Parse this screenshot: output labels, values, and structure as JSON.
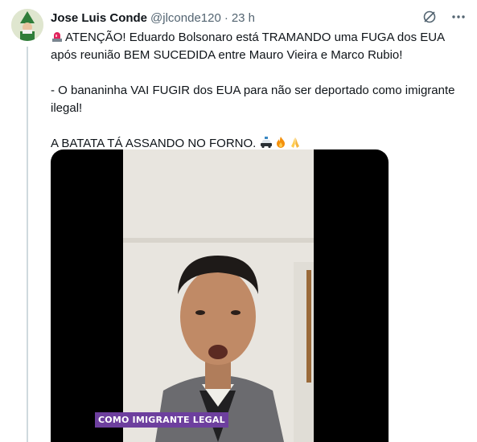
{
  "tweet": {
    "author_name": "Jose Luis Conde",
    "handle": "@jlconde120",
    "separator": "·",
    "time": "23 h",
    "lines": [
      "ATENÇÃO! Eduardo Bolsonaro está TRAMANDO uma FUGA dos EUA após reunião BEM SUCEDIDA entre Mauro Vieira e Marco Rubio!",
      "- O bananinha VAI FUGIR dos EUA para não ser deportado como imigrante ilegal!",
      "A BATATA TÁ ASSANDO NO FORNO."
    ],
    "leading_emoji": "rotating-light-emoji",
    "trailing_emojis": [
      "police-car-emoji",
      "fire-emoji",
      "folded-hands-emoji"
    ]
  },
  "media": {
    "caption": "COMO IMIGRANTE LEGAL"
  },
  "icons": {
    "grok": "grok-icon",
    "more": "more-icon"
  },
  "colors": {
    "text": "#0f1419",
    "muted": "#536471",
    "caption_bg": "#6d3f9e"
  }
}
